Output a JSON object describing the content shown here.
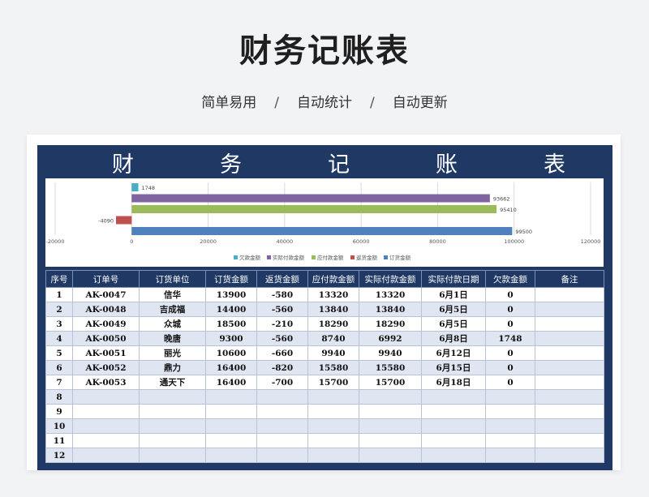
{
  "page": {
    "title": "财务记账表",
    "subtitle_parts": [
      "简单易用",
      "自动统计",
      "自动更新"
    ],
    "separator": "/"
  },
  "sheet": {
    "banner_chars": [
      "财",
      "务",
      "记",
      "账",
      "表"
    ],
    "columns": [
      "序号",
      "订单号",
      "订货单位",
      "订货金额",
      "返货金额",
      "应付款金额",
      "实际付款金额",
      "实际付款日期",
      "欠款金额",
      "备注"
    ],
    "rows": [
      {
        "idx": "1",
        "order": "AK-0047",
        "unit": "信华",
        "amount": "13900",
        "returned": "-580",
        "payable": "13320",
        "paid": "13320",
        "date": "6月1日",
        "debt": "0",
        "note": ""
      },
      {
        "idx": "2",
        "order": "AK-0048",
        "unit": "吉成福",
        "amount": "14400",
        "returned": "-560",
        "payable": "13840",
        "paid": "13840",
        "date": "6月5日",
        "debt": "0",
        "note": ""
      },
      {
        "idx": "3",
        "order": "AK-0049",
        "unit": "众城",
        "amount": "18500",
        "returned": "-210",
        "payable": "18290",
        "paid": "18290",
        "date": "6月5日",
        "debt": "0",
        "note": ""
      },
      {
        "idx": "4",
        "order": "AK-0050",
        "unit": "晚唐",
        "amount": "9300",
        "returned": "-560",
        "payable": "8740",
        "paid": "6992",
        "date": "6月8日",
        "debt": "1748",
        "note": ""
      },
      {
        "idx": "5",
        "order": "AK-0051",
        "unit": "丽光",
        "amount": "10600",
        "returned": "-660",
        "payable": "9940",
        "paid": "9940",
        "date": "6月12日",
        "debt": "0",
        "note": ""
      },
      {
        "idx": "6",
        "order": "AK-0052",
        "unit": "鼎力",
        "amount": "16400",
        "returned": "-820",
        "payable": "15580",
        "paid": "15580",
        "date": "6月15日",
        "debt": "0",
        "note": ""
      },
      {
        "idx": "7",
        "order": "AK-0053",
        "unit": "通天下",
        "amount": "16400",
        "returned": "-700",
        "payable": "15700",
        "paid": "15700",
        "date": "6月18日",
        "debt": "0",
        "note": ""
      },
      {
        "idx": "8",
        "order": "",
        "unit": "",
        "amount": "",
        "returned": "",
        "payable": "",
        "paid": "",
        "date": "",
        "debt": "",
        "note": ""
      },
      {
        "idx": "9",
        "order": "",
        "unit": "",
        "amount": "",
        "returned": "",
        "payable": "",
        "paid": "",
        "date": "",
        "debt": "",
        "note": ""
      },
      {
        "idx": "10",
        "order": "",
        "unit": "",
        "amount": "",
        "returned": "",
        "payable": "",
        "paid": "",
        "date": "",
        "debt": "",
        "note": ""
      },
      {
        "idx": "11",
        "order": "",
        "unit": "",
        "amount": "",
        "returned": "",
        "payable": "",
        "paid": "",
        "date": "",
        "debt": "",
        "note": ""
      },
      {
        "idx": "12",
        "order": "",
        "unit": "",
        "amount": "",
        "returned": "",
        "payable": "",
        "paid": "",
        "date": "",
        "debt": "",
        "note": ""
      }
    ]
  },
  "chart_data": {
    "type": "bar",
    "orientation": "horizontal",
    "series": [
      {
        "name": "欠款金额",
        "value": 1748,
        "color": "#4bacc6"
      },
      {
        "name": "实际付款金额",
        "value": 93662,
        "color": "#8064a2"
      },
      {
        "name": "应付款金额",
        "value": 95410,
        "color": "#9bbb59"
      },
      {
        "name": "返货金额",
        "value": -4090,
        "color": "#c0504d"
      },
      {
        "name": "订货金额",
        "value": 99500,
        "color": "#4f81bd"
      }
    ],
    "xlim": [
      -20000,
      120000
    ],
    "xticks": [
      "-20000",
      "0",
      "20000",
      "40000",
      "60000",
      "80000",
      "100000",
      "120000"
    ],
    "legend_position": "bottom",
    "grid": true
  }
}
